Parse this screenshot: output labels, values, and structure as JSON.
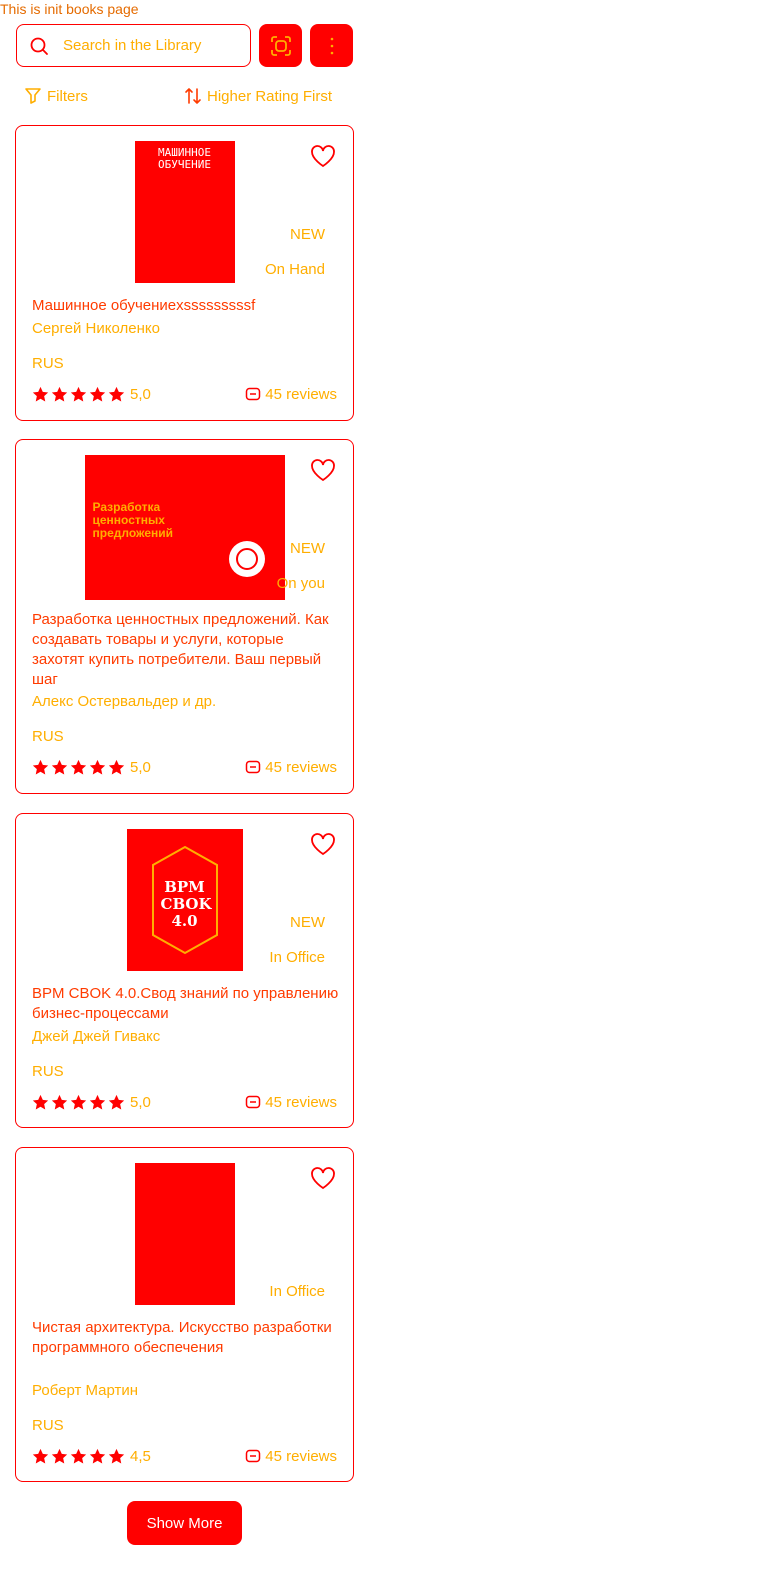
{
  "page": {
    "caption": "This is init books page"
  },
  "search": {
    "placeholder": "Search in the Library"
  },
  "toolbar": {
    "filters_label": "Filters",
    "sort_label": "Higher Rating First"
  },
  "books": [
    {
      "title": "Машинное обучениеxsssssssssf",
      "author": "Сергей Николенко",
      "badge": "NEW",
      "location": "On Hand",
      "language": "RUS",
      "rating": "5,0",
      "reviews": "45 reviews",
      "cover_text": "МАШИННОЕ ОБУЧЕНИЕ"
    },
    {
      "title": "Разработка ценностных предложений. Как создавать товары и услуги, которые захотят купить потребители. Ваш первый шаг",
      "author": "Алекс Остервальдер и др.",
      "badge": "NEW",
      "location": "On you",
      "language": "RUS",
      "rating": "5,0",
      "reviews": "45 reviews",
      "cover_text": "Разработка ценностных предложений"
    },
    {
      "title": "BPM CBOK 4.0.Свод знаний по управлению бизнес-процессами",
      "author": "Джей Джей Гивакс",
      "badge": "NEW",
      "location": "In Office",
      "language": "RUS",
      "rating": "5,0",
      "reviews": "45 reviews",
      "cover_text": "BPM CBOK 4.0"
    },
    {
      "title": "Чистая архитектура. Искусство разработки программного обеспечения",
      "author": "Роберт Мартин",
      "badge": "",
      "location": "In Office",
      "language": "RUS",
      "rating": "4,5",
      "reviews": "45 reviews",
      "cover_text": ""
    }
  ],
  "footer": {
    "show_more_label": "Show More"
  },
  "colors": {
    "primary": "#ff0000",
    "secondary": "#ffae00",
    "title": "#ff3b00"
  }
}
